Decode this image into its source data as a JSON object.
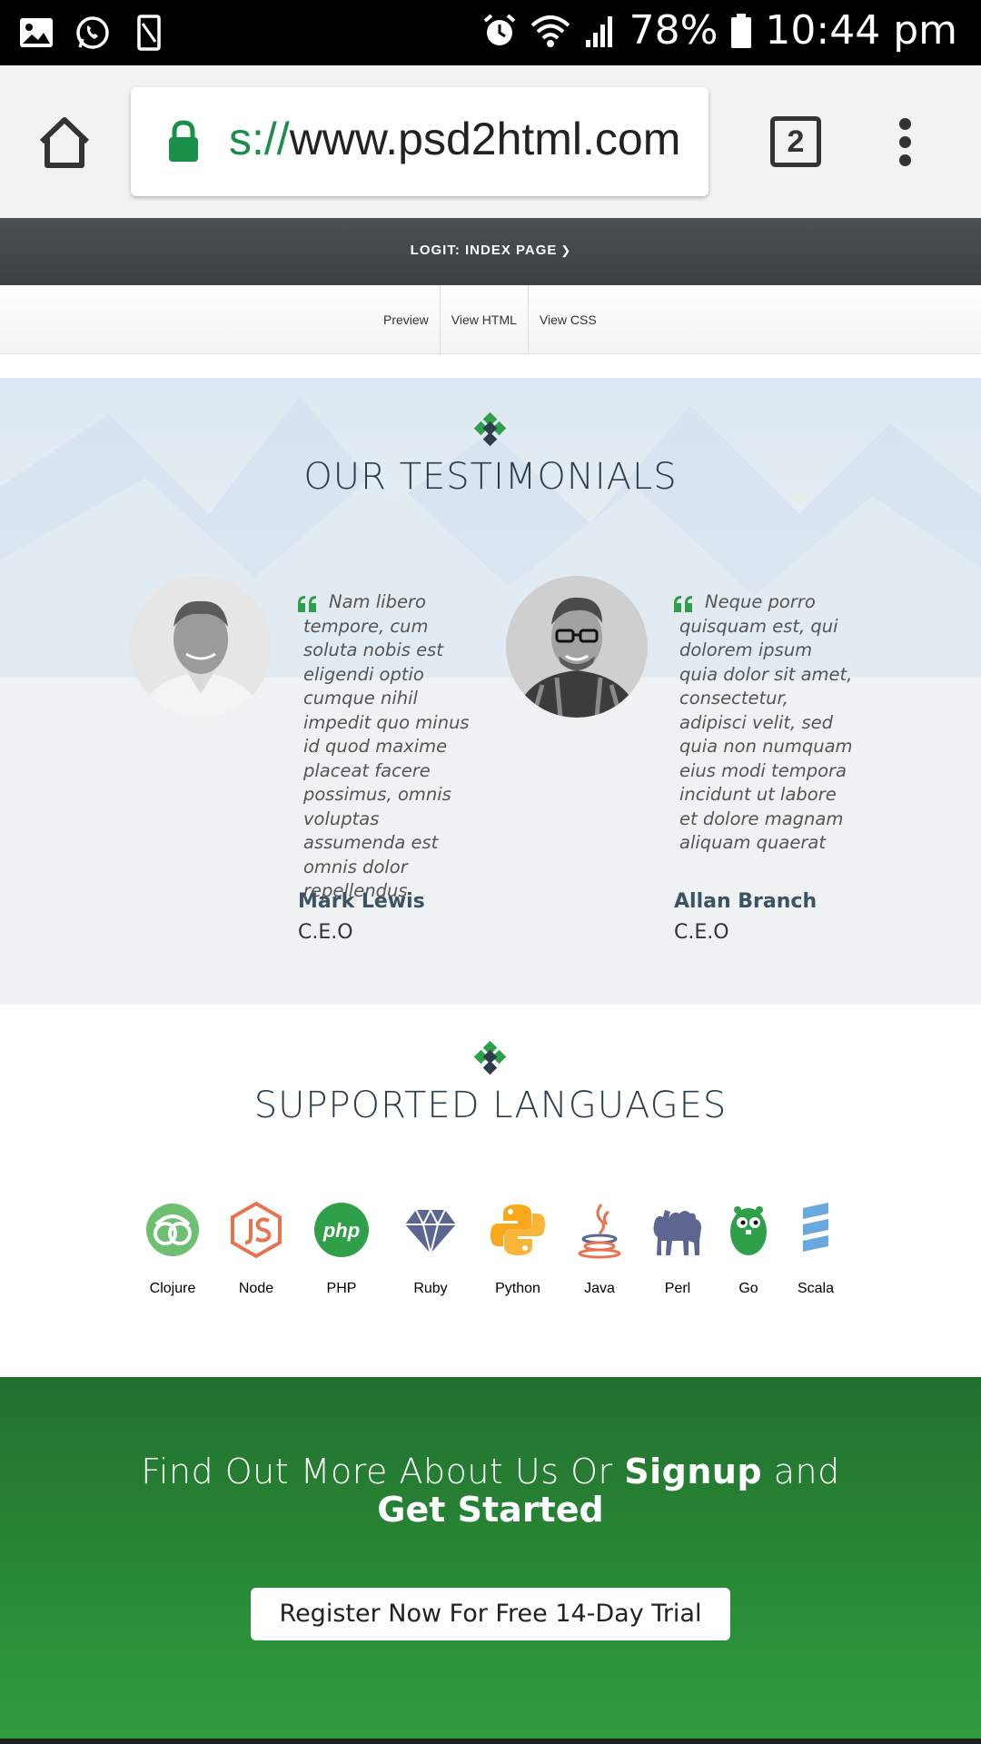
{
  "status_bar": {
    "battery": "78%",
    "time": "10:44 pm",
    "icons": [
      "gallery-icon",
      "whatsapp-icon",
      "phone-icon",
      "alarm-icon",
      "wifi-icon",
      "signal-icon",
      "battery-icon"
    ]
  },
  "browser": {
    "url_scheme": "s://",
    "url_host": "www.psd2html.com",
    "tab_count": "2",
    "secure_color": "#1a8f4a"
  },
  "page_nav": {
    "title": "LOGIT: INDEX PAGE",
    "view_links": [
      "Preview",
      "View HTML",
      "View CSS"
    ]
  },
  "testimonials": {
    "title": "OUR  TESTIMONIALS",
    "items": [
      {
        "quote": "Nam libero tempore, cum soluta nobis est eligendi optio cumque nihil impedit quo minus id quod maxime placeat facere possimus, omnis voluptas assumenda est omnis dolor repellendus",
        "name": "Mark Lewis",
        "role": "C.E.O"
      },
      {
        "quote": "Neque porro quisquam est, qui dolorem ipsum quia dolor sit amet, consectetur, adipisci velit, sed quia non numquam eius modi tempora incidunt ut labore et dolore magnam aliquam quaerat",
        "name": "Allan Branch",
        "role": "C.E.O"
      }
    ]
  },
  "languages": {
    "title": "SUPPORTED  LANGUAGES",
    "items": [
      {
        "name": "Clojure",
        "icon": "clojure-icon",
        "color": "#6fbf73"
      },
      {
        "name": "Node",
        "icon": "node-icon",
        "color": "#e8734f"
      },
      {
        "name": "PHP",
        "icon": "php-icon",
        "color": "#2fa049"
      },
      {
        "name": "Ruby",
        "icon": "ruby-icon",
        "color": "#5c6690"
      },
      {
        "name": "Python",
        "icon": "python-icon",
        "color": "#f7a81b"
      },
      {
        "name": "Java",
        "icon": "java-icon",
        "color": "#e8734f"
      },
      {
        "name": "Perl",
        "icon": "perl-icon",
        "color": "#5c6690"
      },
      {
        "name": "Go",
        "icon": "go-icon",
        "color": "#2fa049"
      },
      {
        "name": "Scala",
        "icon": "scala-icon",
        "color": "#6aa9e0"
      }
    ]
  },
  "cta": {
    "line1_prefix": "Find Out More About Us Or ",
    "line1_bold": "Signup",
    "line1_suffix": " and",
    "line2": "Get Started",
    "button": "Register Now For Free 14-Day Trial",
    "color": "#2e9e3e"
  }
}
